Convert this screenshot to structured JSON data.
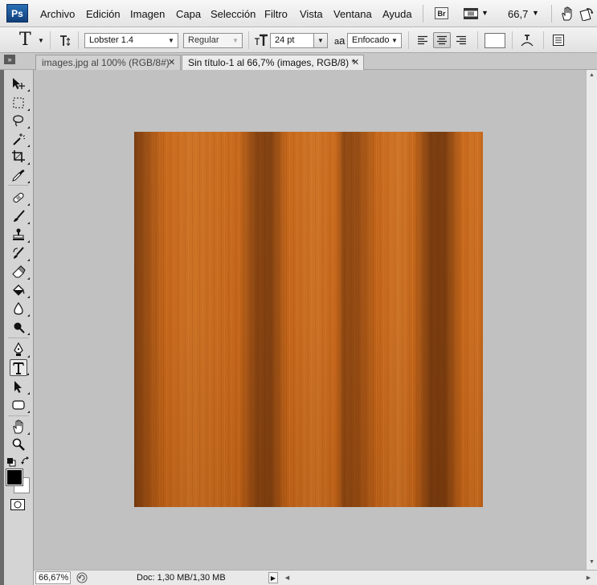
{
  "app": {
    "logo_text": "Ps"
  },
  "menu": {
    "items": [
      "Archivo",
      "Edición",
      "Imagen",
      "Capa",
      "Selección",
      "Filtro",
      "Vista",
      "Ventana",
      "Ayuda"
    ],
    "bridge_label": "Br",
    "zoom": "66,7"
  },
  "options": {
    "tool_glyph": "T",
    "font_family": "Lobster 1.4",
    "font_style": "Regular",
    "font_size": "24 pt",
    "aa_label": "a",
    "antialias": "Enfocado",
    "align_active": "center",
    "text_color": "#ffffff"
  },
  "tabs": [
    {
      "label": "images.jpg al 100% (RGB/8#)",
      "active": false
    },
    {
      "label": "Sin título-1 al 66,7% (images, RGB/8) *",
      "active": true
    }
  ],
  "toolbox": {
    "active_tool": "type",
    "foreground_color": "#000000",
    "background_color": "#ffffff"
  },
  "status": {
    "zoom": "66,67%",
    "doc": "Doc: 1,30 MB/1,30 MB"
  },
  "colors": {
    "wood_base": "#c4661a",
    "wood_dark": "#7a3a0c",
    "workspace": "#c1c1c1"
  }
}
